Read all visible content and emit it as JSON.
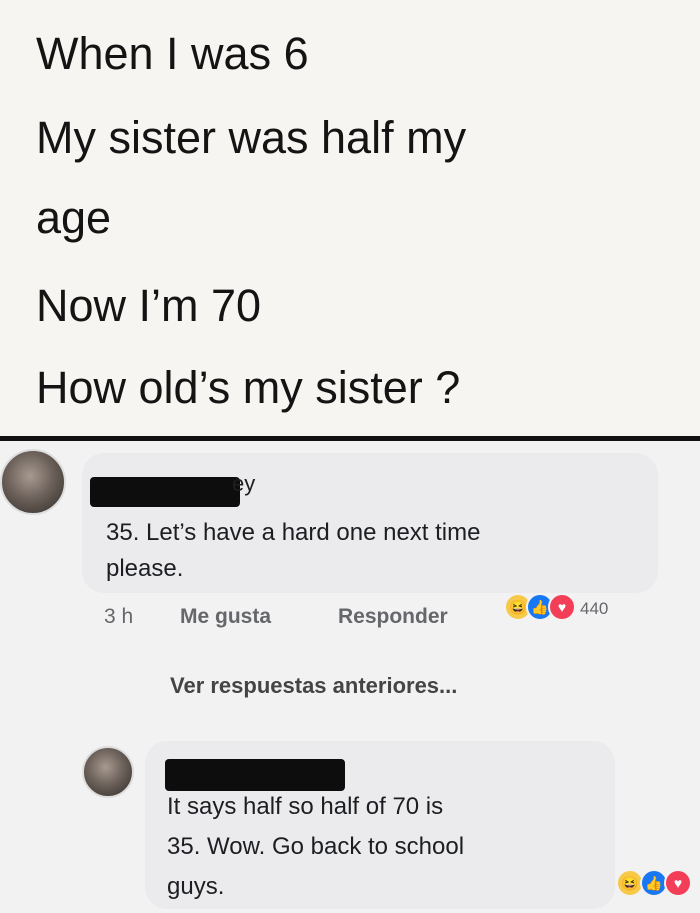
{
  "post": {
    "lines": [
      "When I was 6",
      "My sister was half my",
      "age",
      "Now I’m 70",
      "How old’s my sister ?"
    ]
  },
  "comment1": {
    "name_visible_fragment": "ey",
    "text_lines": [
      "35. Let’s have a hard one next time",
      "please."
    ],
    "time": "3 h",
    "like_label": "Me gusta",
    "reply_label": "Responder",
    "reaction_icons": [
      "haha-icon",
      "like-icon",
      "love-icon"
    ],
    "reaction_count": "440"
  },
  "view_more_replies": "Ver respuestas anteriores...",
  "reply1": {
    "text_lines": [
      "It says half so half of 70 is",
      "35. Wow. Go back to school",
      "guys."
    ],
    "reaction_icons": [
      "haha-icon",
      "like-icon",
      "love-icon"
    ]
  }
}
